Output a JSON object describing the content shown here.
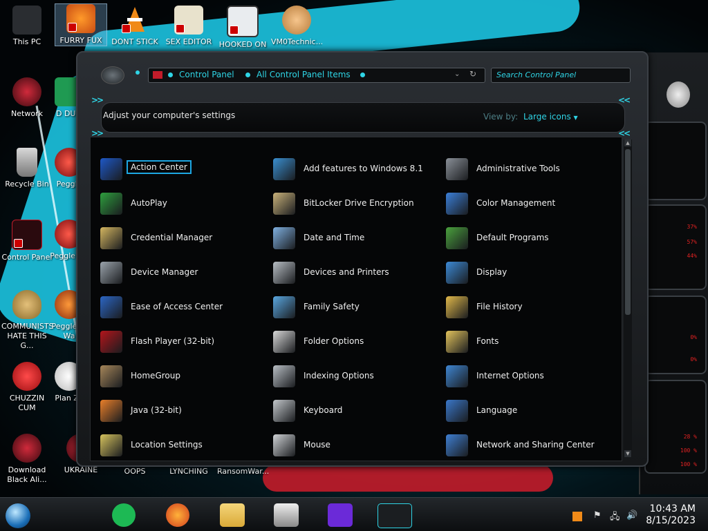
{
  "desktop": {
    "icons": [
      {
        "label": "This PC"
      },
      {
        "label": "FURRY FUX"
      },
      {
        "label": "DONT STICK"
      },
      {
        "label": "SEX EDITOR"
      },
      {
        "label": "HOOKED ON"
      },
      {
        "label": "VM0Technic..."
      },
      {
        "label": "Network"
      },
      {
        "label": "D DUM"
      },
      {
        "label": "Recycle Bin"
      },
      {
        "label": "Peggle"
      },
      {
        "label": "Control Panel"
      },
      {
        "label": "Peggle De"
      },
      {
        "label": "COMMUNISTS HATE THIS G..."
      },
      {
        "label": "Peggle of Wa"
      },
      {
        "label": "CHUZZIN CUM"
      },
      {
        "label": "Plan Zo"
      },
      {
        "label": "Download Black Ali..."
      },
      {
        "label": "UKRAINE"
      },
      {
        "label": "OOPS"
      },
      {
        "label": "LYNCHING"
      },
      {
        "label": "RansomWar..."
      }
    ]
  },
  "gadget": {
    "percents": [
      "37%",
      "57%",
      "44%",
      "0%",
      "0%",
      "28 %",
      "100 %",
      "100 %"
    ]
  },
  "window": {
    "breadcrumb": [
      "Control Panel",
      "All Control Panel Items"
    ],
    "search_placeholder": "Search Control Panel",
    "header_title": "Adjust your computer's settings",
    "view_by_label": "View by:",
    "view_by_value": "Large icons",
    "view_by_arrow": "▼",
    "items": [
      {
        "label": "Action Center",
        "icon": "flag-icon",
        "color": "#1e58c7"
      },
      {
        "label": "Add features to Windows 8.1",
        "icon": "monitor-upgrade-icon",
        "color": "#3a8fd0"
      },
      {
        "label": "Administrative Tools",
        "icon": "gears-icon",
        "color": "#8a9098"
      },
      {
        "label": "AutoPlay",
        "icon": "autoplay-icon",
        "color": "#2e9e3e"
      },
      {
        "label": "BitLocker Drive Encryption",
        "icon": "key-icon",
        "color": "#c9b27a"
      },
      {
        "label": "Color Management",
        "icon": "color-icon",
        "color": "#3b7fd8"
      },
      {
        "label": "Credential Manager",
        "icon": "vault-icon",
        "color": "#d4b660"
      },
      {
        "label": "Date and Time",
        "icon": "calendar-clock-icon",
        "color": "#7fb0e0"
      },
      {
        "label": "Default Programs",
        "icon": "default-programs-icon",
        "color": "#4aa13d"
      },
      {
        "label": "Device Manager",
        "icon": "device-manager-icon",
        "color": "#9aa3ab"
      },
      {
        "label": "Devices and Printers",
        "icon": "printer-icon",
        "color": "#b8bec4"
      },
      {
        "label": "Display",
        "icon": "display-icon",
        "color": "#3c8ad6"
      },
      {
        "label": "Ease of Access Center",
        "icon": "ease-of-access-icon",
        "color": "#2c66c4"
      },
      {
        "label": "Family Safety",
        "icon": "family-safety-icon",
        "color": "#5aa7e0"
      },
      {
        "label": "File History",
        "icon": "file-history-icon",
        "color": "#e0b84a"
      },
      {
        "label": "Flash Player (32-bit)",
        "icon": "flash-icon",
        "color": "#b3151b"
      },
      {
        "label": "Folder Options",
        "icon": "folder-options-icon",
        "color": "#d8d8d8"
      },
      {
        "label": "Fonts",
        "icon": "fonts-icon",
        "color": "#e2c35c"
      },
      {
        "label": "HomeGroup",
        "icon": "homegroup-icon",
        "color": "#a6865a"
      },
      {
        "label": "Indexing Options",
        "icon": "indexing-icon",
        "color": "#b8bec4"
      },
      {
        "label": "Internet Options",
        "icon": "internet-icon",
        "color": "#3f86d2"
      },
      {
        "label": "Java (32-bit)",
        "icon": "java-icon",
        "color": "#e97f2a"
      },
      {
        "label": "Keyboard",
        "icon": "keyboard-icon",
        "color": "#c3c7cb"
      },
      {
        "label": "Language",
        "icon": "language-icon",
        "color": "#3a77c9"
      },
      {
        "label": "Location Settings",
        "icon": "location-icon",
        "color": "#d6c35e"
      },
      {
        "label": "Mouse",
        "icon": "mouse-icon",
        "color": "#d0d3d6"
      },
      {
        "label": "Network and Sharing Center",
        "icon": "network-sharing-icon",
        "color": "#3f7fd2"
      }
    ]
  },
  "taskbar": {
    "time": "10:43 AM",
    "date": "8/15/2023"
  }
}
